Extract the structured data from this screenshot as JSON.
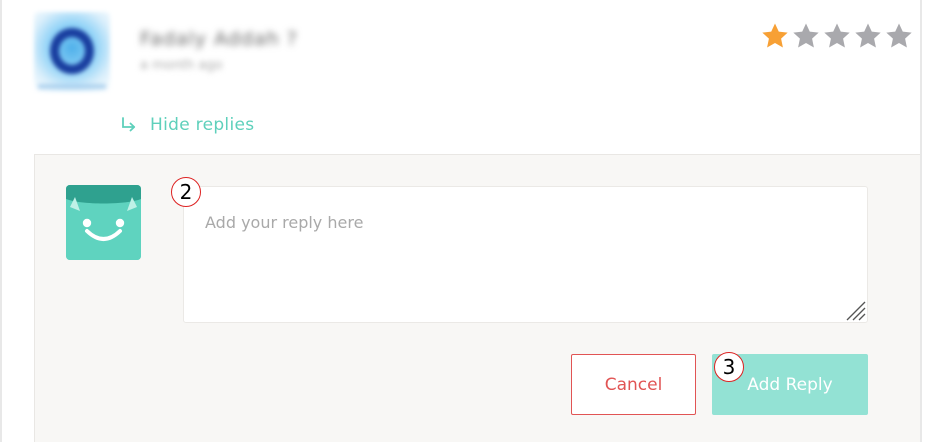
{
  "review": {
    "reviewer_name": "Fadaly Addah ?",
    "date": "a month ago",
    "avatar_icon": "app-logo-icon",
    "rating": 1,
    "rating_max": 5,
    "colors": {
      "star_filled": "#f7a035",
      "star_empty": "#a9a9ad"
    }
  },
  "replies_toggle": {
    "label": "Hide replies",
    "icon": "reply-arrow-icon",
    "color": "#5ed0bb"
  },
  "reply_form": {
    "avatar_icon": "smiling-face-avatar-icon",
    "input": {
      "placeholder": "Add your reply here",
      "value": ""
    },
    "cancel_label": "Cancel",
    "submit_label": "Add Reply",
    "colors": {
      "cancel": "#e15454",
      "submit_bg": "#93e2d4",
      "panel_bg": "#f8f7f5"
    }
  },
  "annotations": {
    "marker_textarea": "2",
    "marker_submit": "3"
  }
}
